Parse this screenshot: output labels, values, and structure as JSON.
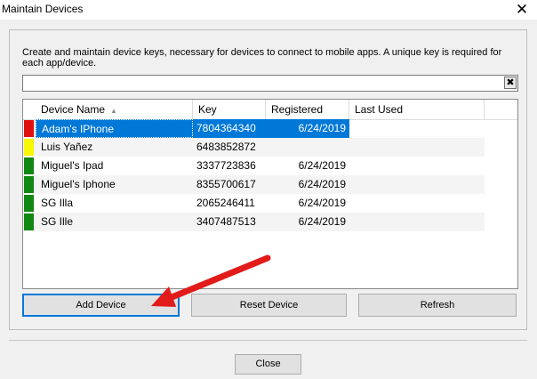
{
  "window": {
    "title": "Maintain Devices"
  },
  "description": "Create and maintain device keys, necessary for devices to connect to mobile apps.  A unique key is required for each app/device.",
  "search": {
    "value": "",
    "clear_label": "✖"
  },
  "table": {
    "columns": [
      {
        "label": "Device Name",
        "sort": "ascending"
      },
      {
        "label": "Key"
      },
      {
        "label": "Registered"
      },
      {
        "label": "Last Used"
      }
    ],
    "rows": [
      {
        "status_color": "#e01010",
        "name": "Adam's IPhone",
        "key": "7804364340",
        "registered": "6/24/2019",
        "last_used": "",
        "selected": true
      },
      {
        "status_color": "#f8f800",
        "name": "Luis Yañez",
        "key": "6483852872",
        "registered": "",
        "last_used": ""
      },
      {
        "status_color": "#118811",
        "name": "Miguel's Ipad",
        "key": "3337723836",
        "registered": "6/24/2019",
        "last_used": ""
      },
      {
        "status_color": "#118811",
        "name": "Miguel's Iphone",
        "key": "8355700617",
        "registered": "6/24/2019",
        "last_used": ""
      },
      {
        "status_color": "#118811",
        "name": "SG Illa",
        "key": "2065246411",
        "registered": "6/24/2019",
        "last_used": ""
      },
      {
        "status_color": "#118811",
        "name": "SG Ille",
        "key": "3407487513",
        "registered": "6/24/2019",
        "last_used": ""
      }
    ]
  },
  "buttons": {
    "add": "Add Device",
    "reset": "Reset Device",
    "refresh": "Refresh",
    "close": "Close"
  },
  "colors": {
    "selection": "#0078d7",
    "annotation_arrow": "#e21b1b"
  }
}
